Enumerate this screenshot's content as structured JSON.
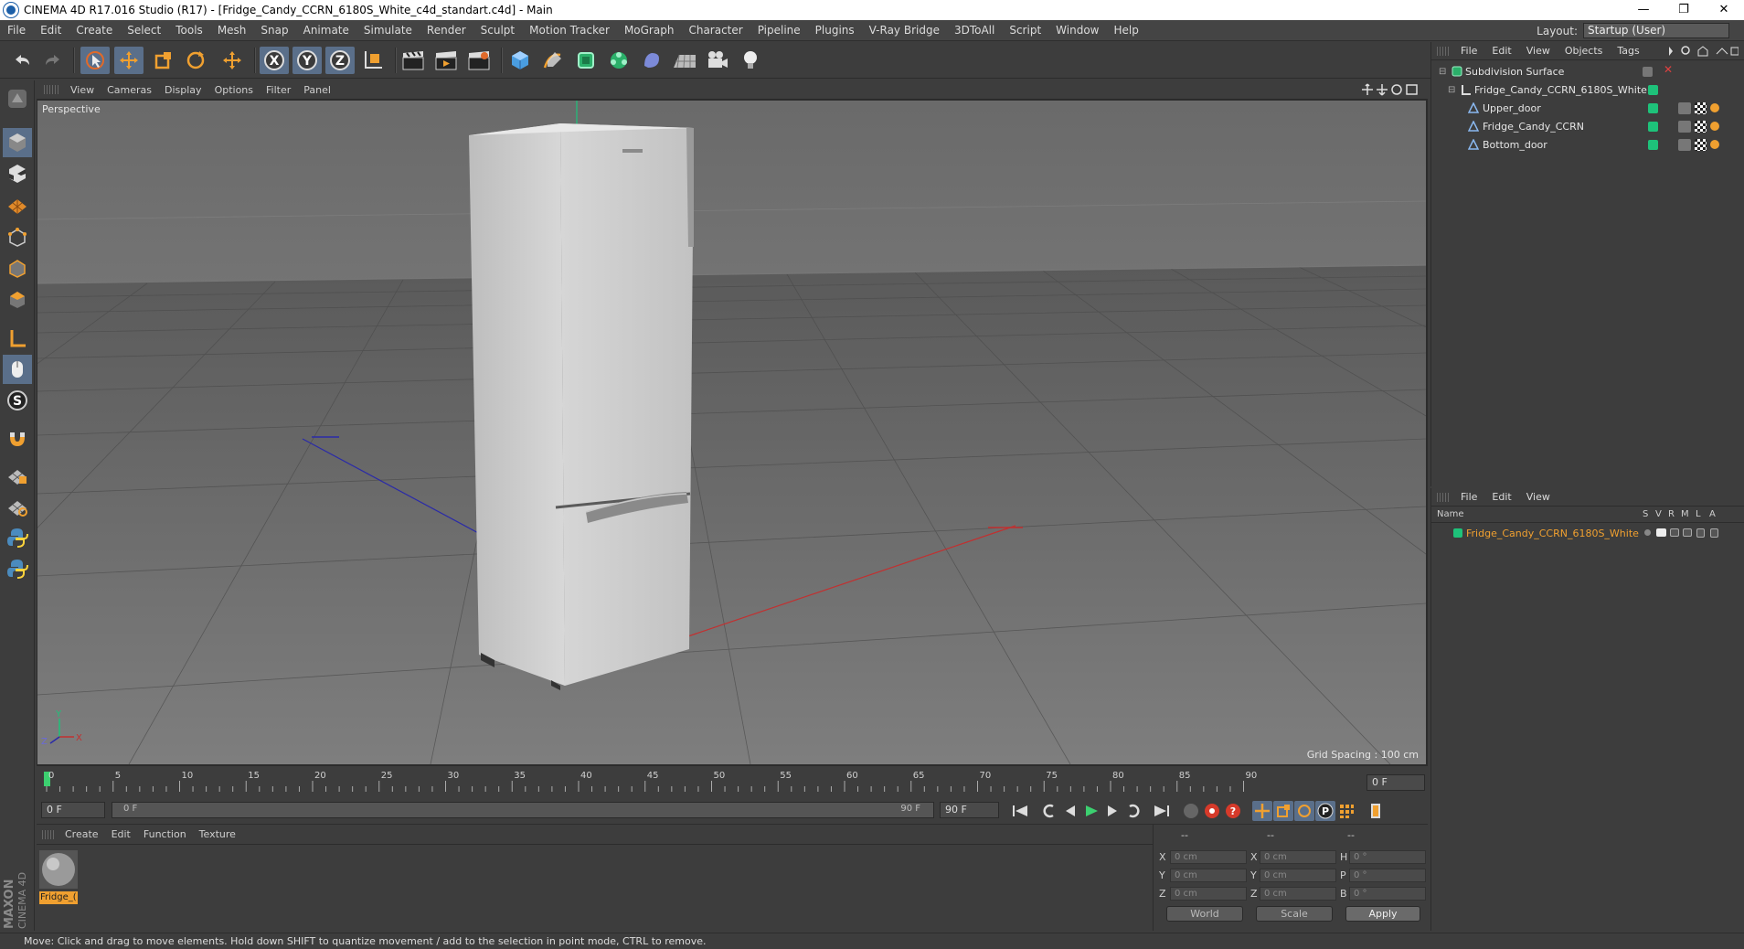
{
  "window": {
    "title": "CINEMA 4D R17.016 Studio (R17) - [Fridge_Candy_CCRN_6180S_White_c4d_standart.c4d] - Main",
    "minimize": "—",
    "restore": "❐",
    "close": "✕"
  },
  "menubar": {
    "items": [
      "File",
      "Edit",
      "Create",
      "Select",
      "Tools",
      "Mesh",
      "Snap",
      "Animate",
      "Simulate",
      "Render",
      "Sculpt",
      "Motion Tracker",
      "MoGraph",
      "Character",
      "Pipeline",
      "Plugins",
      "V-Ray Bridge",
      "3DToAll",
      "Script",
      "Window",
      "Help"
    ],
    "layout_label": "Layout:",
    "layout_value": "Startup (User)"
  },
  "viewport": {
    "menu": [
      "View",
      "Cameras",
      "Display",
      "Options",
      "Filter",
      "Panel"
    ],
    "label": "Perspective",
    "grid_spacing": "Grid Spacing : 100 cm",
    "axis_y": "Y",
    "axis_z": "Z",
    "axis_x": "X"
  },
  "timeline": {
    "ticks": [
      "0",
      "5",
      "10",
      "15",
      "20",
      "25",
      "30",
      "35",
      "40",
      "45",
      "50",
      "55",
      "60",
      "65",
      "70",
      "75",
      "80",
      "85",
      "90"
    ],
    "current_frame": "0 F"
  },
  "transport": {
    "start_field": "0 F",
    "range_start": "0 F",
    "range_end": "90 F",
    "end_field": "90 F"
  },
  "materials": {
    "menu": [
      "Create",
      "Edit",
      "Function",
      "Texture"
    ],
    "material_name": "Fridge_("
  },
  "coords": {
    "header": [
      "--",
      "--",
      "--"
    ],
    "rows": [
      {
        "a": "X",
        "av": "0 cm",
        "b": "X",
        "bv": "0 cm",
        "c": "H",
        "cv": "0 °"
      },
      {
        "a": "Y",
        "av": "0 cm",
        "b": "Y",
        "bv": "0 cm",
        "c": "P",
        "cv": "0 °"
      },
      {
        "a": "Z",
        "av": "0 cm",
        "b": "Z",
        "bv": "0 cm",
        "c": "B",
        "cv": "0 °"
      }
    ],
    "mode1": "World",
    "mode2": "Scale",
    "apply": "Apply"
  },
  "object_manager": {
    "menu": [
      "File",
      "Edit",
      "View",
      "Objects",
      "Tags"
    ],
    "objects": [
      {
        "name": "Subdivision Surface"
      },
      {
        "name": "Fridge_Candy_CCRN_6180S_White"
      },
      {
        "name": "Upper_door"
      },
      {
        "name": "Fridge_Candy_CCRN"
      },
      {
        "name": "Bottom_door"
      }
    ]
  },
  "attribute_manager": {
    "menu": [
      "File",
      "Edit",
      "View"
    ],
    "col_name": "Name",
    "cols": [
      "S",
      "V",
      "R",
      "M",
      "L",
      "A"
    ],
    "row_name": "Fridge_Candy_CCRN_6180S_White"
  },
  "statusbar": {
    "text": "Move: Click and drag to move elements. Hold down SHIFT to quantize movement / add to the selection in point mode, CTRL to remove."
  },
  "brand": {
    "maxon": "MAXON",
    "cinema": "CINEMA 4D"
  },
  "colors": {
    "accent": "#5a6f8a",
    "green_tag": "#1ec27a",
    "orange_text": "#f0a030",
    "timeline_green": "#3cd070"
  }
}
